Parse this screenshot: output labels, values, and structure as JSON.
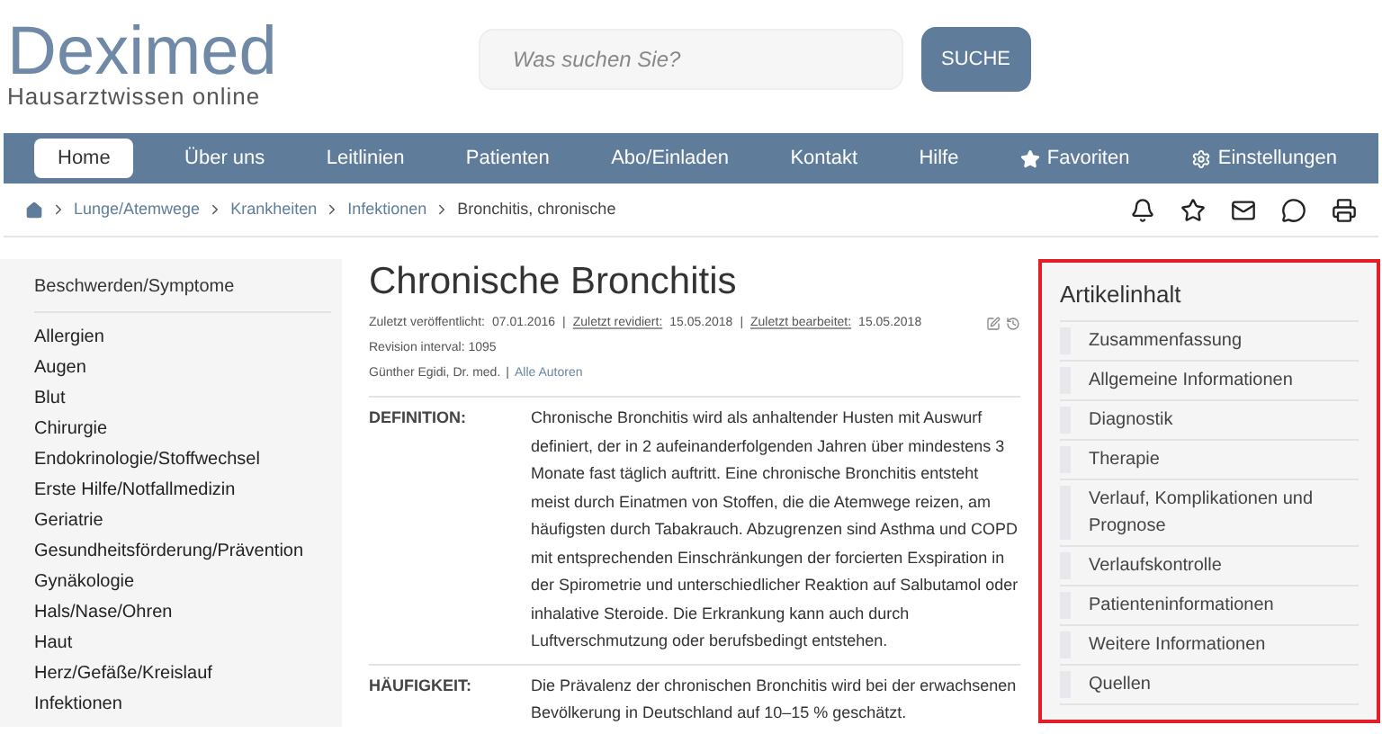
{
  "logo": {
    "name": "Deximed",
    "tagline": "Hausarztwissen online"
  },
  "search": {
    "placeholder": "Was suchen Sie?",
    "button": "SUCHE"
  },
  "nav": [
    {
      "label": "Home",
      "selected": true,
      "kind": "text"
    },
    {
      "label": "Über uns",
      "selected": false,
      "kind": "text"
    },
    {
      "label": "Leitlinien",
      "selected": false,
      "kind": "text"
    },
    {
      "label": "Patienten",
      "selected": false,
      "kind": "text"
    },
    {
      "label": "Abo/Einladen",
      "selected": false,
      "kind": "text"
    },
    {
      "label": "Kontakt",
      "selected": false,
      "kind": "text"
    },
    {
      "label": "Hilfe",
      "selected": false,
      "kind": "text"
    },
    {
      "label": "Favoriten",
      "selected": false,
      "kind": "star"
    },
    {
      "label": "Einstellungen",
      "selected": false,
      "kind": "gear"
    }
  ],
  "breadcrumb": [
    "Lunge/Atemwege",
    "Krankheiten",
    "Infektionen",
    "Bronchitis, chronische"
  ],
  "sidebar": {
    "heading": "Beschwerden/Symptome",
    "items": [
      "Allergien",
      "Augen",
      "Blut",
      "Chirurgie",
      "Endokrinologie/Stoffwechsel",
      "Erste Hilfe/Notfallmedizin",
      "Geriatrie",
      "Gesundheitsförderung/Prävention",
      "Gynäkologie",
      "Hals/Nase/Ohren",
      "Haut",
      "Herz/Gefäße/Kreislauf",
      "Infektionen"
    ]
  },
  "article": {
    "title": "Chronische Bronchitis",
    "meta": [
      {
        "label": "Zuletzt veröffentlicht:",
        "value": "07.01.2016",
        "underlined": false
      },
      {
        "label": "Zuletzt revidiert:",
        "value": "15.05.2018",
        "underlined": true
      },
      {
        "label": "Zuletzt bearbeitet:",
        "value": "15.05.2018",
        "underlined": true
      }
    ],
    "separator": "|",
    "revision": "Revision interval: 1095",
    "author": "Günther Egidi, Dr. med.",
    "authors_link": "Alle Autoren",
    "sections": [
      {
        "label": "DEFINITION:",
        "text": "Chronische Bronchitis wird als anhaltender Husten mit Auswurf definiert, der in 2 aufeinanderfolgenden Jahren über mindestens 3 Monate fast täglich auftritt. Eine chronische Bronchitis entsteht meist durch Einatmen von Stoffen, die die Atemwege reizen, am häufigsten durch Tabakrauch. Abzugrenzen sind Asthma und COPD mit entsprechenden Einschränkungen der forcierten Exspiration in der Spirometrie und unterschiedlicher Reaktion auf Salbutamol oder inhalative Steroide. Die Erkrankung kann auch durch Luftverschmutzung oder berufsbedingt entstehen."
      },
      {
        "label": "HÄUFIGKEIT:",
        "text": "Die Prävalenz der chronischen Bronchitis wird bei der erwachsenen Bevölkerung in Deutschland auf 10–15 % geschätzt."
      }
    ]
  },
  "toc": {
    "heading": "Artikelinhalt",
    "items": [
      "Zusammenfassung",
      "Allgemeine Informationen",
      "Diagnostik",
      "Therapie",
      "Verlauf, Komplikationen und Prognose",
      "Verlaufskontrolle",
      "Patienteninformationen",
      "Weitere Informationen",
      "Quellen"
    ]
  }
}
